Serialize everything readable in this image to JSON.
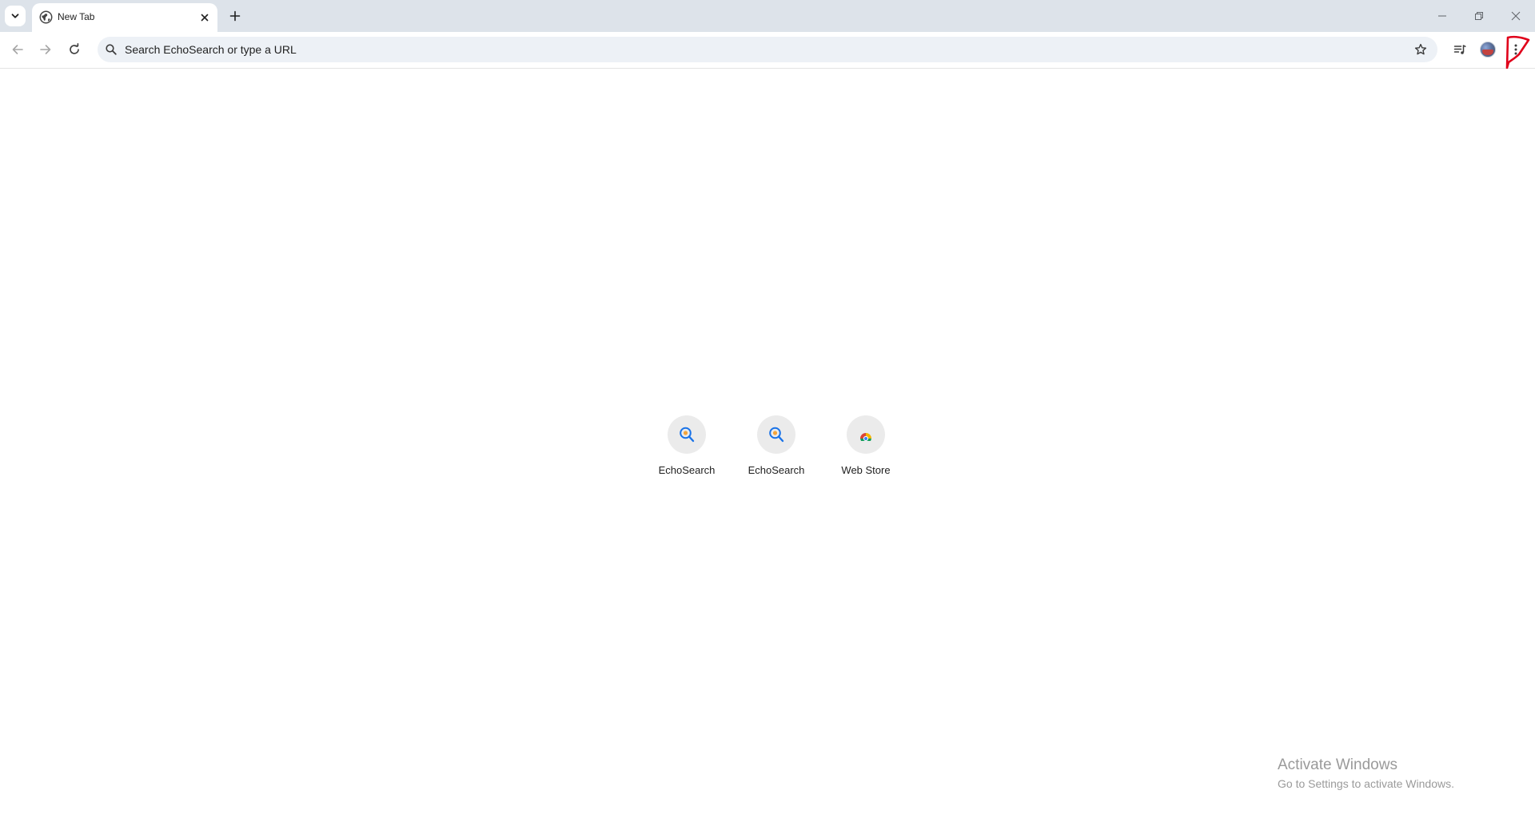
{
  "tab_strip": {
    "active_tab": {
      "title": "New Tab",
      "favicon": "globe-icon"
    }
  },
  "toolbar": {
    "omnibox": {
      "placeholder": "Search EchoSearch or type a URL",
      "value": ""
    }
  },
  "shortcuts": [
    {
      "label": "EchoSearch",
      "icon": "echosearch-icon"
    },
    {
      "label": "EchoSearch",
      "icon": "echosearch-icon"
    },
    {
      "label": "Web Store",
      "icon": "web-store-icon"
    }
  ],
  "watermark": {
    "title": "Activate Windows",
    "subtitle": "Go to Settings to activate Windows."
  },
  "colors": {
    "tabstrip_bg": "#dde3ea",
    "omnibox_bg": "#edf1f6",
    "shortcut_tile_bg": "#ebebeb",
    "annotation_red": "#e0001a",
    "echosearch_blue": "#1a73e8",
    "echosearch_orange": "#f4a43a"
  }
}
